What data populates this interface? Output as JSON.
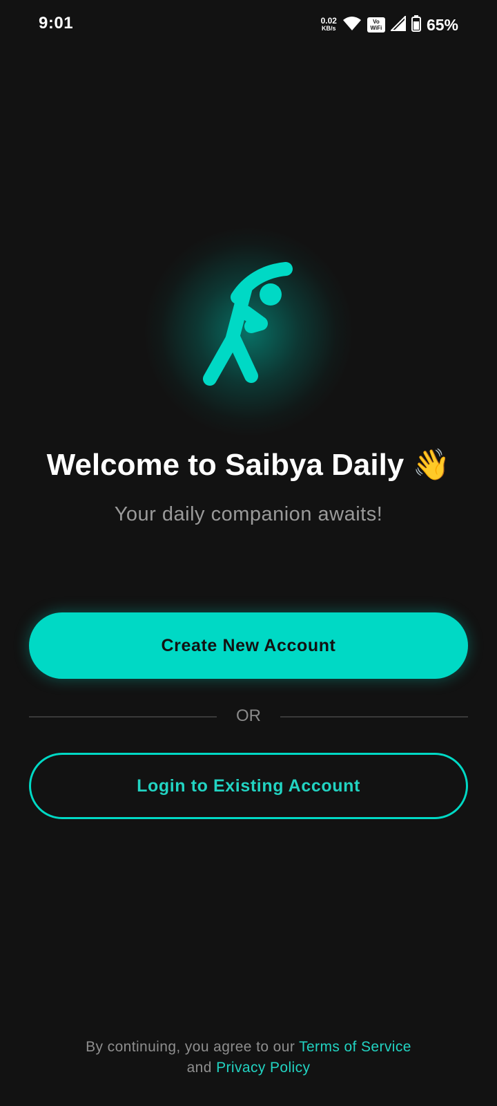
{
  "status_bar": {
    "time": "9:01",
    "net_speed_value": "0.02",
    "net_speed_unit": "KB/s",
    "vowifi_top": "Vo",
    "vowifi_bottom": "WiFi",
    "battery_percent": "65%",
    "icons": [
      "wifi-icon",
      "vowifi-icon",
      "cell-signal-icon",
      "battery-icon"
    ]
  },
  "logo": {
    "icon": "stretching-person-icon",
    "accent_color": "#00D9C5"
  },
  "welcome": {
    "title": "Welcome to Saibya Daily",
    "emoji": "👋",
    "subtitle": "Your daily companion awaits!"
  },
  "actions": {
    "create_label": "Create New Account",
    "or_label": "OR",
    "login_label": "Login to Existing Account"
  },
  "legal": {
    "prefix": "By continuing, you agree to our",
    "terms_link": "Terms of Service",
    "and_text": "and",
    "privacy_link": "Privacy Policy"
  },
  "colors": {
    "background": "#121212",
    "accent": "#00D9C5",
    "muted_text": "#9A9A9A"
  }
}
